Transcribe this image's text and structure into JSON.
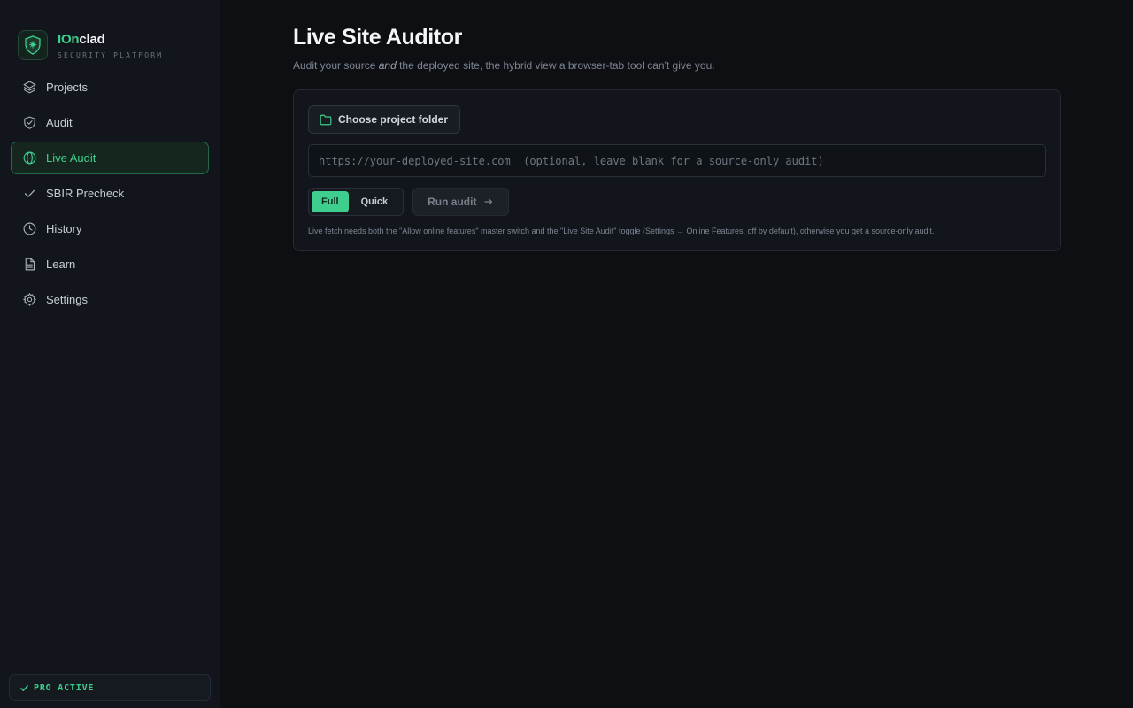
{
  "brand": {
    "name_accent": "IOn",
    "name_rest": "clad",
    "subtitle": "SECURITY PLATFORM",
    "accent_color": "#3ecf8e"
  },
  "sidebar": {
    "items": [
      {
        "label": "Projects",
        "icon": "layers-icon",
        "active": false
      },
      {
        "label": "Audit",
        "icon": "shield-check-icon",
        "active": false
      },
      {
        "label": "Live Audit",
        "icon": "globe-icon",
        "active": true
      },
      {
        "label": "SBIR Precheck",
        "icon": "check-icon",
        "active": false
      },
      {
        "label": "History",
        "icon": "clock-icon",
        "active": false
      },
      {
        "label": "Learn",
        "icon": "document-icon",
        "active": false
      },
      {
        "label": "Settings",
        "icon": "gear-icon",
        "active": false
      }
    ],
    "pro_badge": "PRO ACTIVE"
  },
  "main": {
    "title": "Live Site Auditor",
    "subtitle_before": "Audit your source ",
    "subtitle_em": "and",
    "subtitle_after": " the deployed site, the hybrid view a browser-tab tool can't give you.",
    "folder_button": "Choose project folder",
    "url_placeholder": "https://your-deployed-site.com  (optional, leave blank for a source-only audit)",
    "url_value": "",
    "mode_options": [
      "Full",
      "Quick"
    ],
    "mode_selected": "Full",
    "run_button": "Run audit",
    "note": "Live fetch needs both the \"Allow online features\" master switch and the \"Live Site Audit\" toggle (Settings → Online Features, off by default), otherwise you get a source-only audit."
  }
}
